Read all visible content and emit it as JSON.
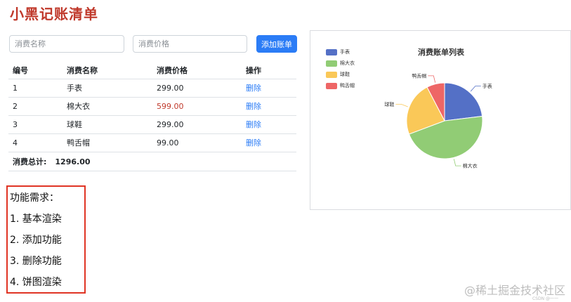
{
  "app": {
    "title": "小黑记账清单"
  },
  "form": {
    "name_placeholder": "消费名称",
    "price_placeholder": "消费价格",
    "add_button_label": "添加账单"
  },
  "table": {
    "headers": [
      "编号",
      "消费名称",
      "消费价格",
      "操作"
    ],
    "rows": [
      {
        "id": "1",
        "name": "手表",
        "price": "299.00",
        "action": "删除"
      },
      {
        "id": "2",
        "name": "棉大衣",
        "price": "599.00",
        "action": "删除"
      },
      {
        "id": "3",
        "name": "球鞋",
        "price": "299.00",
        "action": "删除"
      },
      {
        "id": "4",
        "name": "鸭舌帽",
        "price": "99.00",
        "action": "删除"
      }
    ],
    "total_label": "消费总计:",
    "total_value": "1296.00"
  },
  "requirements": {
    "heading": "功能需求：",
    "items": [
      "1. 基本渲染",
      "2. 添加功能",
      "3. 删除功能",
      "4. 饼图渲染"
    ]
  },
  "chart_data": {
    "type": "pie",
    "title": "消费账单列表",
    "legend_position": "top-left",
    "categories": [
      "手表",
      "棉大衣",
      "球鞋",
      "鸭舌帽"
    ],
    "values": [
      299,
      599,
      299,
      99
    ],
    "colors": [
      "#5470c6",
      "#91cc75",
      "#fac858",
      "#ee6666"
    ]
  },
  "colors": {
    "accent": "#2b7cf6",
    "title": "#c0392b",
    "price_high": "#c0392b"
  },
  "watermark": {
    "main": "@稀土掘金技术社区",
    "small": "CSDN @一一"
  }
}
